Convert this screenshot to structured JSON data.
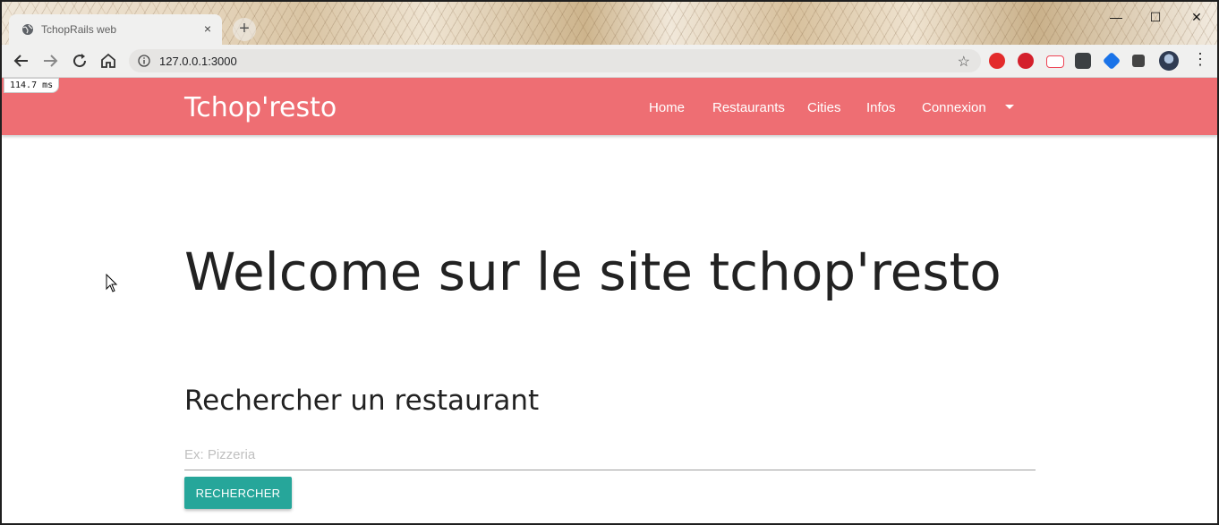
{
  "browser": {
    "tab_title": "TchopRails web",
    "tab_close": "×",
    "new_tab": "+",
    "url": "127.0.0.1:3000",
    "bookmark_star": "☆",
    "window_controls": {
      "minimize": "—",
      "maximize": "☐",
      "close": "✕"
    },
    "menu_dots": "⋮"
  },
  "timing_badge": "114.7 ms",
  "site_nav": {
    "brand": "Tchop'resto",
    "items": [
      "Home",
      "Restaurants",
      "Cities",
      "Infos",
      "Connexion"
    ]
  },
  "main": {
    "welcome": "Welcome sur le site tchop'resto",
    "search_title": "Rechercher un restaurant",
    "search_placeholder": "Ex: Pizzeria",
    "search_button": "RECHERCHER"
  },
  "colors": {
    "nav_bg": "#ee6e73",
    "button_bg": "#26a69a"
  },
  "icons": [
    "globe-icon",
    "back-arrow-icon",
    "forward-arrow-icon",
    "reload-icon",
    "home-icon",
    "info-icon",
    "star-icon",
    "adblock-icon",
    "pinterest-icon",
    "pdf-icon",
    "dots-extension-icon",
    "cube-extension-icon",
    "puzzle-extensions-icon",
    "profile-avatar-icon",
    "kebab-menu-icon",
    "cursor-icon",
    "dropdown-caret-icon"
  ]
}
